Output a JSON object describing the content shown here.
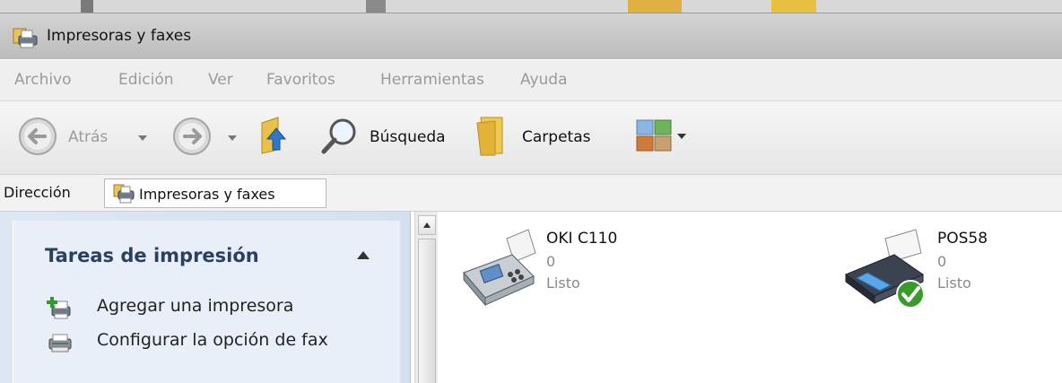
{
  "window": {
    "title": "Impresoras y faxes"
  },
  "menu": {
    "items": [
      "Archivo",
      "Edición",
      "Ver",
      "Favoritos",
      "Herramientas",
      "Ayuda"
    ]
  },
  "toolbar": {
    "back_label": "Atrás",
    "search_label": "Búsqueda",
    "folders_label": "Carpetas"
  },
  "address": {
    "label": "Dirección",
    "value": "Impresoras y faxes"
  },
  "task_pane": {
    "title": "Tareas de impresión",
    "tasks": [
      {
        "label": "Agregar una impresora",
        "icon": "add-printer-icon"
      },
      {
        "label": "Configurar la opción de fax",
        "icon": "fax-printer-icon"
      }
    ]
  },
  "printers": [
    {
      "name": "OKI C110",
      "count": "0",
      "status": "Listo",
      "icon": "fax-machine-icon",
      "default": false
    },
    {
      "name": "POS58",
      "count": "0",
      "status": "Listo",
      "icon": "printer-icon",
      "default": true
    }
  ],
  "colors": {
    "task_pane_bg": "#dde7f4",
    "task_title": "#2b3f61",
    "menu_text_disabled": "#9a9a9a",
    "default_check": "#3a9a2c"
  }
}
